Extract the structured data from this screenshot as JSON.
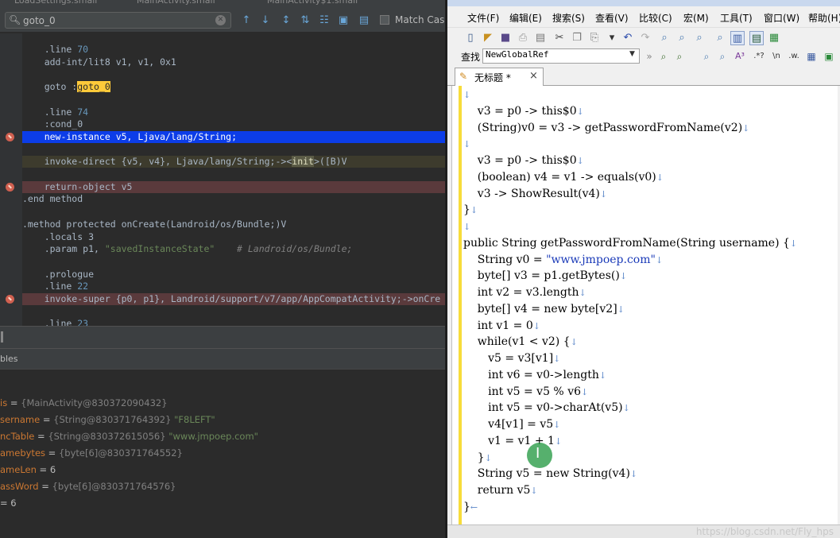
{
  "ide": {
    "tabs": [
      "LoadSettings.smali",
      "MainActivity.smali",
      "MainActivity$1.smali"
    ],
    "search": {
      "value": "goto_0",
      "placeholder": "",
      "match_case_label": "Match Case"
    },
    "code_lines": [
      {
        "kind": "line_dir",
        "text": "    .line 70"
      },
      {
        "kind": "plain",
        "text": "    add-int/lit8 v1, v1, 0x1"
      },
      {
        "kind": "blank",
        "text": ""
      },
      {
        "kind": "goto",
        "prefix": "    goto :",
        "label": "goto_0"
      },
      {
        "kind": "blank",
        "text": ""
      },
      {
        "kind": "line_dir",
        "text": "    .line 74"
      },
      {
        "kind": "plain",
        "text": "    :cond_0"
      },
      {
        "kind": "plain",
        "text": "    new-instance v5, Ljava/lang/String;",
        "highlight": "blue",
        "breakpoint": true
      },
      {
        "kind": "blank",
        "text": ""
      },
      {
        "kind": "invoke",
        "prefix": "    invoke-direct {v5, v4}, Ljava/lang/String;-><",
        "mid": "init",
        "suffix": ">([B)V",
        "highlight": "olive"
      },
      {
        "kind": "blank",
        "text": ""
      },
      {
        "kind": "plain",
        "text": "    return-object v5",
        "highlight": "red",
        "breakpoint": true
      },
      {
        "kind": "plain",
        "text": ".end method"
      },
      {
        "kind": "blank",
        "text": ""
      },
      {
        "kind": "plain",
        "text": ".method protected onCreate(Landroid/os/Bundle;)V"
      },
      {
        "kind": "plain",
        "text": "    .locals 3"
      },
      {
        "kind": "param",
        "prefix": "    .param p1, ",
        "string": "\"savedInstanceState\"",
        "comment": "    # Landroid/os/Bundle;"
      },
      {
        "kind": "blank",
        "text": ""
      },
      {
        "kind": "plain",
        "text": "    .prologue"
      },
      {
        "kind": "line_dir",
        "text": "    .line 22"
      },
      {
        "kind": "plain",
        "text": "    invoke-super {p0, p1}, Landroid/support/v7/app/AppCompatActivity;->onCre",
        "highlight": "red",
        "breakpoint": true
      },
      {
        "kind": "blank",
        "text": ""
      },
      {
        "kind": "line_dir",
        "text": "    .line 23"
      }
    ],
    "variables_title": "bles",
    "variables": [
      {
        "name": "is",
        "eq": " = ",
        "type": "{MainActivity@830372090432}",
        "value": ""
      },
      {
        "name": "sername",
        "eq": " = ",
        "type": "{String@830371764392} ",
        "value": "\"F8LEFT\""
      },
      {
        "name": "ncTable",
        "eq": " = ",
        "type": "{String@830372615056} ",
        "value": "\"www.jmpoep.com\""
      },
      {
        "name": "amebytes",
        "eq": " = ",
        "type": "{byte[6]@830371764552}",
        "value": ""
      },
      {
        "name": "ameLen",
        "eq": " = ",
        "type": "",
        "value": "6"
      },
      {
        "name": "assWord",
        "eq": " = ",
        "type": "{byte[6]@830371764576}",
        "value": ""
      },
      {
        "name": "",
        "eq": "= ",
        "type": "",
        "value": "6"
      }
    ]
  },
  "emeditor": {
    "menus": [
      "文件(F)",
      "编辑(E)",
      "搜索(S)",
      "查看(V)",
      "比较(C)",
      "宏(M)",
      "工具(T)",
      "窗口(W)",
      "帮助(H)"
    ],
    "find_label": "查找",
    "find_value": "NewGlobalRef",
    "tab_label": "无标题 *",
    "lines": [
      {
        "text": "",
        "ret": "↓"
      },
      {
        "text": "    v3 = p0 -> this$0",
        "ret": "↓"
      },
      {
        "text": "    (String)v0 = v3 -> getPasswordFromName(v2)",
        "ret": "↓"
      },
      {
        "text": "",
        "ret": "↓"
      },
      {
        "text": "    v3 = p0 -> this$0",
        "ret": "↓"
      },
      {
        "text": "    (boolean) v4 = v1 -> equals(v0)",
        "ret": "↓"
      },
      {
        "text": "    v3 -> ShowResult(v4)",
        "ret": "↓"
      },
      {
        "text": "}",
        "ret": "↓"
      },
      {
        "text": "",
        "ret": "↓"
      },
      {
        "text": "public String getPasswordFromName(String username) {",
        "ret": "↓"
      },
      {
        "text": "    String v0 = ",
        "url": "\"www.jmpoep.com\"",
        "ret": "↓"
      },
      {
        "text": "    byte[] v3 = p1.getBytes()",
        "ret": "↓"
      },
      {
        "text": "    int v2 = v3.length",
        "ret": "↓"
      },
      {
        "text": "    byte[] v4 = new byte[v2]",
        "ret": "↓"
      },
      {
        "text": "    int v1 = 0",
        "ret": "↓"
      },
      {
        "text": "    while(v1 < v2) {",
        "ret": "↓"
      },
      {
        "text": "       v5 = v3[v1]",
        "ret": "↓"
      },
      {
        "text": "       int v6 = v0->length",
        "ret": "↓"
      },
      {
        "text": "       int v5 = v5 % v6",
        "ret": "↓"
      },
      {
        "text": "       int v5 = v0->charAt(v5)",
        "ret": "↓"
      },
      {
        "text": "       v4[v1] = v5",
        "ret": "↓"
      },
      {
        "text": "       v1 = v1 + 1",
        "ret": "↓"
      },
      {
        "text": "    }",
        "ret": "↓"
      },
      {
        "text": "    String v5 = new String(v4)",
        "ret": "↓"
      },
      {
        "text": "    return v5",
        "ret": "↓"
      },
      {
        "text": "}",
        "ret": "←"
      }
    ],
    "watermark": "https://blog.csdn.net/Fly_hps"
  },
  "colors": {
    "blue_highlight": "#0c3de8",
    "breakpoint": "#d06050",
    "margin_yellow": "#f7dc3a",
    "keyword": "#cc7832"
  }
}
